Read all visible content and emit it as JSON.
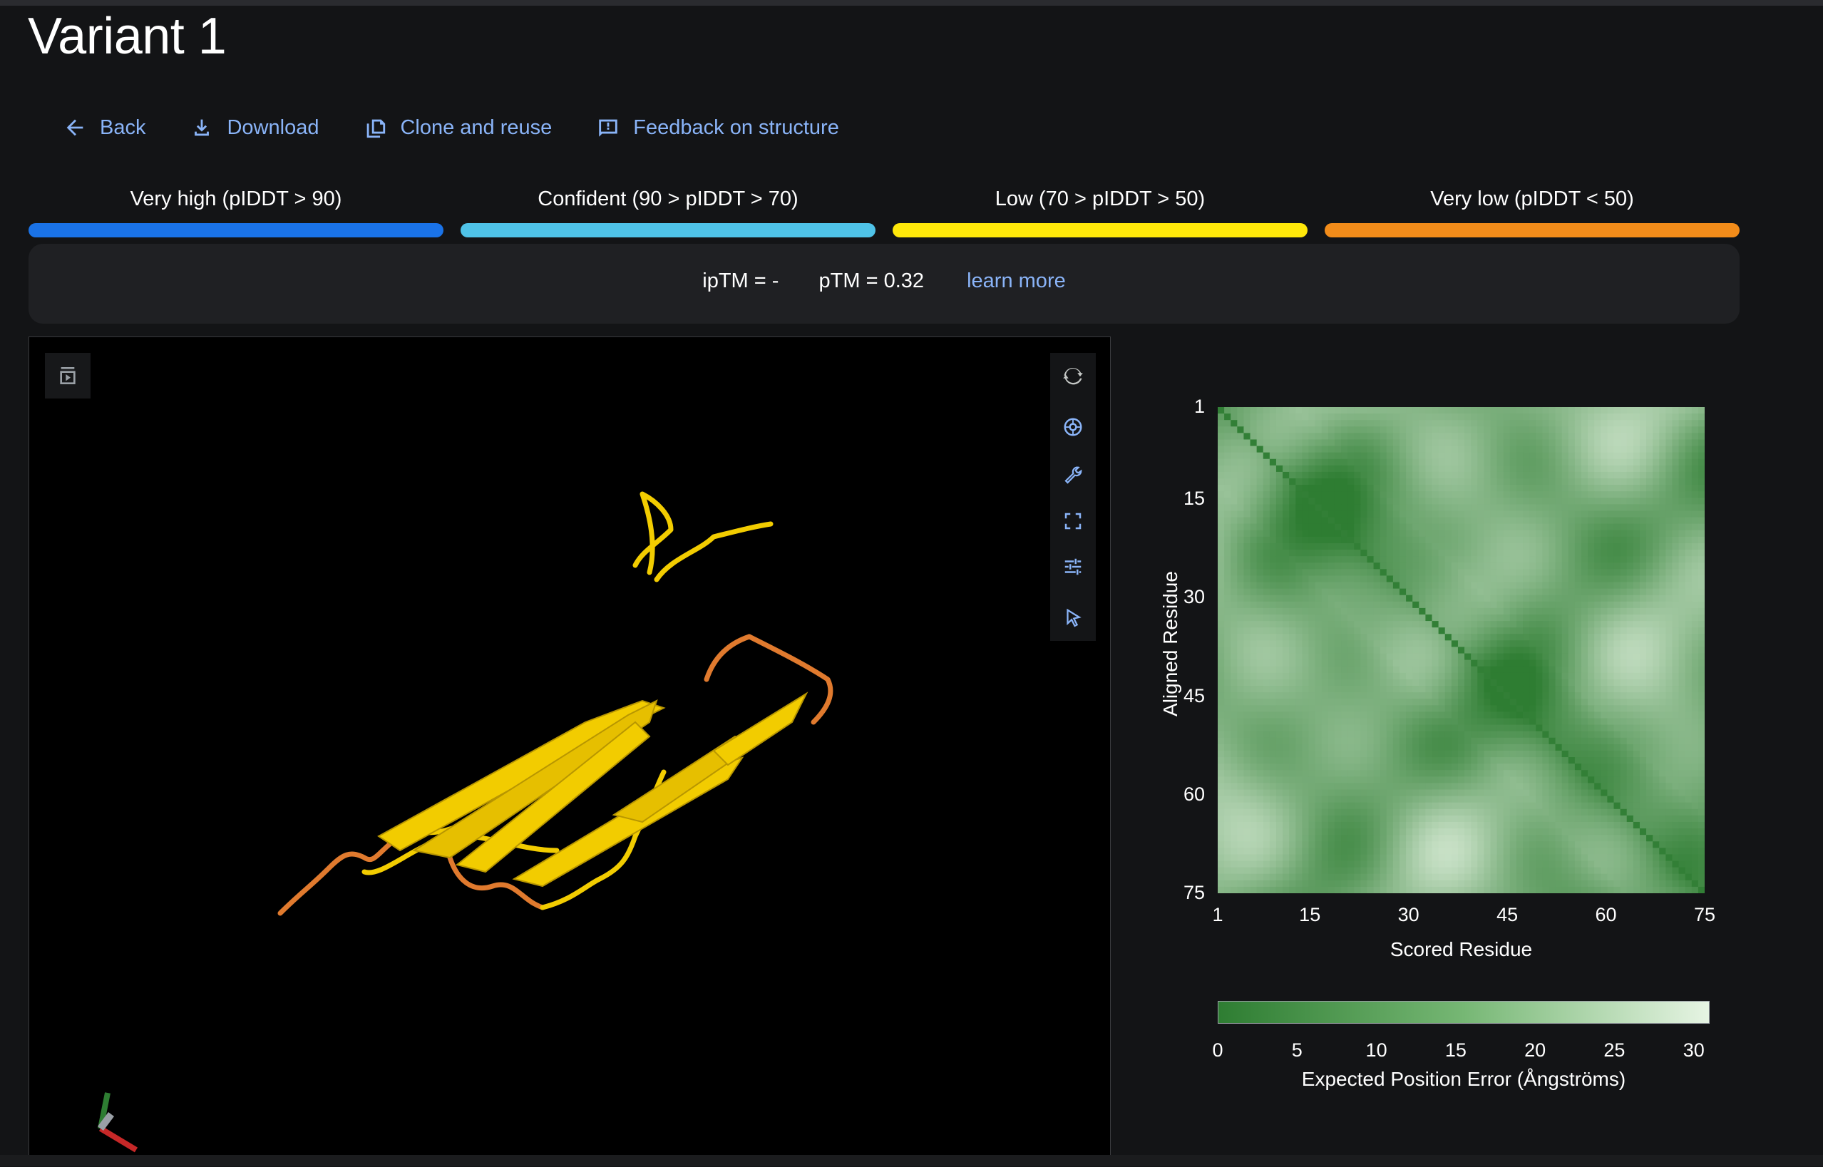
{
  "title": "Variant 1",
  "actions": {
    "back": "Back",
    "download": "Download",
    "clone": "Clone and reuse",
    "feedback": "Feedback on structure"
  },
  "legend": [
    {
      "label": "Very high (pIDDT > 90)",
      "color": "#1a73e8"
    },
    {
      "label": "Confident (90 > pIDDT > 70)",
      "color": "#4fc3e8"
    },
    {
      "label": "Low (70 > pIDDT > 50)",
      "color": "#ffe80a"
    },
    {
      "label": "Very low (pIDDT < 50)",
      "color": "#f28c1a"
    }
  ],
  "metrics": {
    "iptm": "ipTM = -",
    "ptm": "pTM = 0.32",
    "learn_more": "learn more"
  },
  "viewer": {
    "tools": [
      "rotate-icon",
      "camera-icon",
      "wrench-icon",
      "fullscreen-icon",
      "sliders-icon",
      "pointer-icon"
    ],
    "structure_color_primary": "#f2cc00",
    "structure_color_low": "#e07a2e"
  },
  "chart_data": {
    "type": "heatmap",
    "title": "",
    "xlabel": "Scored Residue",
    "ylabel": "Aligned Residue",
    "x_ticks": [
      "1",
      "15",
      "30",
      "45",
      "60",
      "75"
    ],
    "y_ticks": [
      "1",
      "15",
      "30",
      "45",
      "60",
      "75"
    ],
    "n_residues": 75,
    "colorbar": {
      "label": "Expected Position Error (Ångströms)",
      "ticks": [
        "0",
        "5",
        "10",
        "15",
        "20",
        "25",
        "30"
      ],
      "range": [
        0,
        31
      ],
      "color_low": "#2e7d32",
      "color_high": "#e6f4e3"
    },
    "description_values": "diagonal ~0-3 Å, off-diagonal ~8-28 Å"
  }
}
